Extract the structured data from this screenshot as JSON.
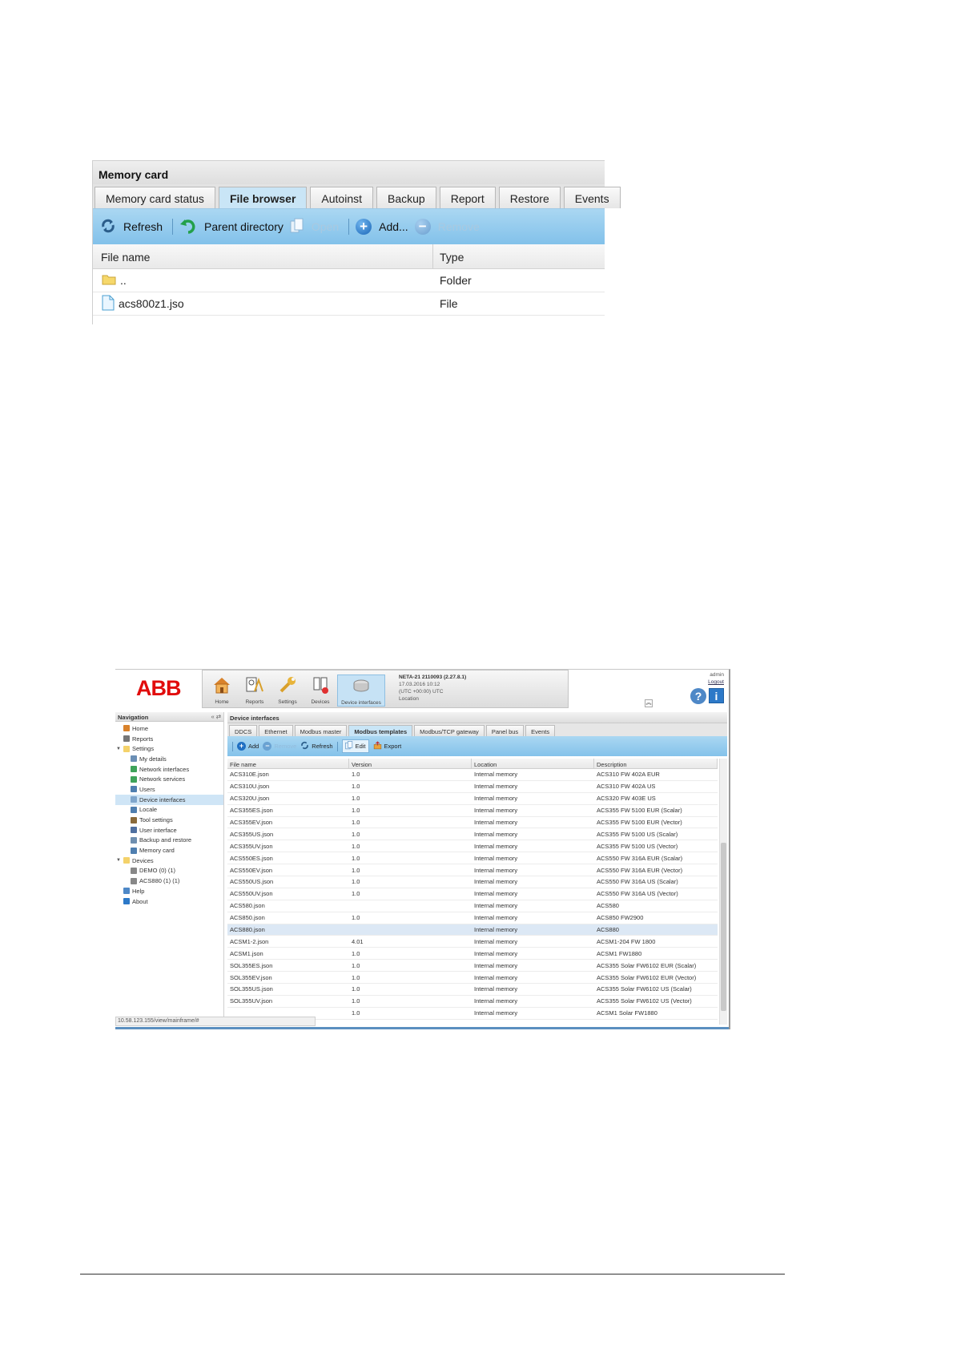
{
  "memory_card": {
    "title": "Memory card",
    "tabs": [
      {
        "label": "Memory card status",
        "active": false
      },
      {
        "label": "File browser",
        "active": true
      },
      {
        "label": "Autoinst",
        "active": false
      },
      {
        "label": "Backup",
        "active": false
      },
      {
        "label": "Report",
        "active": false
      },
      {
        "label": "Restore",
        "active": false
      },
      {
        "label": "Events",
        "active": false
      }
    ],
    "toolbar": {
      "refresh": "Refresh",
      "parent_directory": "Parent directory",
      "open": "Open",
      "add": "Add...",
      "remove": "Remove"
    },
    "columns": {
      "name": "File name",
      "type": "Type"
    },
    "rows": [
      {
        "name": "..",
        "type": "Folder",
        "icon": "folder-icon"
      },
      {
        "name": "acs800z1.jso",
        "type": "File",
        "icon": "file-icon"
      }
    ],
    "colors": {
      "toolbar": "#8fc9ee",
      "active_tab": "#c9e5f6"
    }
  },
  "neta": {
    "logo": "ABB",
    "nav_buttons": [
      {
        "label": "Home",
        "icon": "home-icon"
      },
      {
        "label": "Reports",
        "icon": "reports-icon"
      },
      {
        "label": "Settings",
        "icon": "wrench-icon"
      },
      {
        "label": "Devices",
        "icon": "devices-icon"
      },
      {
        "label": "Device interfaces",
        "icon": "device-interfaces-icon"
      }
    ],
    "device_info": {
      "name": "NETA-21 2110093 (2.27.8.1)",
      "date": "17.03.2016 10:12",
      "tz": "(UTC +00:00) UTC",
      "location": "Location"
    },
    "user": {
      "name": "admin",
      "logout": "Logout"
    },
    "navigation": {
      "title": "Navigation",
      "controls": "« ⇄",
      "items": [
        {
          "label": "Home",
          "level": 1,
          "icon": "home-icon",
          "color": "#d9822b"
        },
        {
          "label": "Reports",
          "level": 1,
          "icon": "reports-icon",
          "color": "#777777"
        },
        {
          "label": "Settings",
          "level": 0,
          "icon": "folder-icon",
          "color": "#f4d26a",
          "expanded": true
        },
        {
          "label": "My details",
          "level": 2,
          "icon": "user-icon",
          "color": "#6b8fb5"
        },
        {
          "label": "Network interfaces",
          "level": 2,
          "icon": "network-icon",
          "color": "#3fa35a"
        },
        {
          "label": "Network services",
          "level": 2,
          "icon": "globe-icon",
          "color": "#3fa35a"
        },
        {
          "label": "Users",
          "level": 2,
          "icon": "users-icon",
          "color": "#4f7fb0"
        },
        {
          "label": "Device interfaces",
          "level": 2,
          "icon": "plug-icon",
          "color": "#7fa6cc",
          "selected": true
        },
        {
          "label": "Locale",
          "level": 2,
          "icon": "locale-icon",
          "color": "#4f7fb0"
        },
        {
          "label": "Tool settings",
          "level": 2,
          "icon": "tool-icon",
          "color": "#8a6a3a"
        },
        {
          "label": "User interface",
          "level": 2,
          "icon": "ui-icon",
          "color": "#4f6fa0"
        },
        {
          "label": "Backup and restore",
          "level": 2,
          "icon": "backup-icon",
          "color": "#6f8fb0"
        },
        {
          "label": "Memory card",
          "level": 2,
          "icon": "memory-card-icon",
          "color": "#4f7fb0"
        },
        {
          "label": "Devices",
          "level": 0,
          "icon": "folder-icon",
          "color": "#f4d26a",
          "expanded": true
        },
        {
          "label": "DEMO (0) (1)",
          "level": 2,
          "icon": "device-icon",
          "color": "#888888"
        },
        {
          "label": "ACS880 (1) (1)",
          "level": 2,
          "icon": "device-icon",
          "color": "#888888"
        },
        {
          "label": "Help",
          "level": 1,
          "icon": "help-icon",
          "color": "#4e88c7"
        },
        {
          "label": "About",
          "level": 1,
          "icon": "info-icon",
          "color": "#2d79c8"
        }
      ]
    },
    "main": {
      "title": "Device interfaces",
      "tabs": [
        {
          "label": "DDCS",
          "active": false
        },
        {
          "label": "Ethernet",
          "active": false
        },
        {
          "label": "Modbus master",
          "active": false
        },
        {
          "label": "Modbus templates",
          "active": true
        },
        {
          "label": "Modbus/TCP gateway",
          "active": false
        },
        {
          "label": "Panel bus",
          "active": false
        },
        {
          "label": "Events",
          "active": false
        }
      ],
      "toolbar": {
        "add": "Add",
        "remove": "Remove",
        "refresh": "Refresh",
        "edit": "Edit",
        "export": "Export"
      },
      "columns": [
        "File name",
        "Version",
        "Location",
        "Description"
      ],
      "rows": [
        [
          "ACS310E.json",
          "1.0",
          "Internal memory",
          "ACS310 FW 402A EUR"
        ],
        [
          "ACS310U.json",
          "1.0",
          "Internal memory",
          "ACS310 FW 402A US"
        ],
        [
          "ACS320U.json",
          "1.0",
          "Internal memory",
          "ACS320 FW 403E US"
        ],
        [
          "ACS355ES.json",
          "1.0",
          "Internal memory",
          "ACS355 FW 5100 EUR (Scalar)"
        ],
        [
          "ACS355EV.json",
          "1.0",
          "Internal memory",
          "ACS355 FW 5100 EUR (Vector)"
        ],
        [
          "ACS355US.json",
          "1.0",
          "Internal memory",
          "ACS355 FW 5100 US (Scalar)"
        ],
        [
          "ACS355UV.json",
          "1.0",
          "Internal memory",
          "ACS355 FW 5100 US (Vector)"
        ],
        [
          "ACS550ES.json",
          "1.0",
          "Internal memory",
          "ACS550 FW 316A EUR (Scalar)"
        ],
        [
          "ACS550EV.json",
          "1.0",
          "Internal memory",
          "ACS550 FW 316A EUR (Vector)"
        ],
        [
          "ACS550US.json",
          "1.0",
          "Internal memory",
          "ACS550 FW 316A US (Scalar)"
        ],
        [
          "ACS550UV.json",
          "1.0",
          "Internal memory",
          "ACS550 FW 316A US (Vector)"
        ],
        [
          "ACS580.json",
          "",
          "Internal memory",
          "ACS580"
        ],
        [
          "ACS850.json",
          "1.0",
          "Internal memory",
          "ACS850 FW2900"
        ],
        [
          "ACS880.json",
          "",
          "Internal memory",
          "ACS880"
        ],
        [
          "ACSM1-2.json",
          "4.01",
          "Internal memory",
          "ACSM1-204 FW 1800"
        ],
        [
          "ACSM1.json",
          "1.0",
          "Internal memory",
          "ACSM1 FW1880"
        ],
        [
          "SOL355ES.json",
          "1.0",
          "Internal memory",
          "ACS355 Solar FW6102 EUR (Scalar)"
        ],
        [
          "SOL355EV.json",
          "1.0",
          "Internal memory",
          "ACS355 Solar FW6102 EUR (Vector)"
        ],
        [
          "SOL355US.json",
          "1.0",
          "Internal memory",
          "ACS355 Solar FW6102 US (Scalar)"
        ],
        [
          "SOL355UV.json",
          "1.0",
          "Internal memory",
          "ACS355 Solar FW6102 US (Vector)"
        ],
        [
          "",
          "1.0",
          "Internal memory",
          "ACSM1 Solar FW1880"
        ]
      ],
      "selected_row": 13
    },
    "status_url": "10.58.123.155/view/mainframe/#"
  }
}
